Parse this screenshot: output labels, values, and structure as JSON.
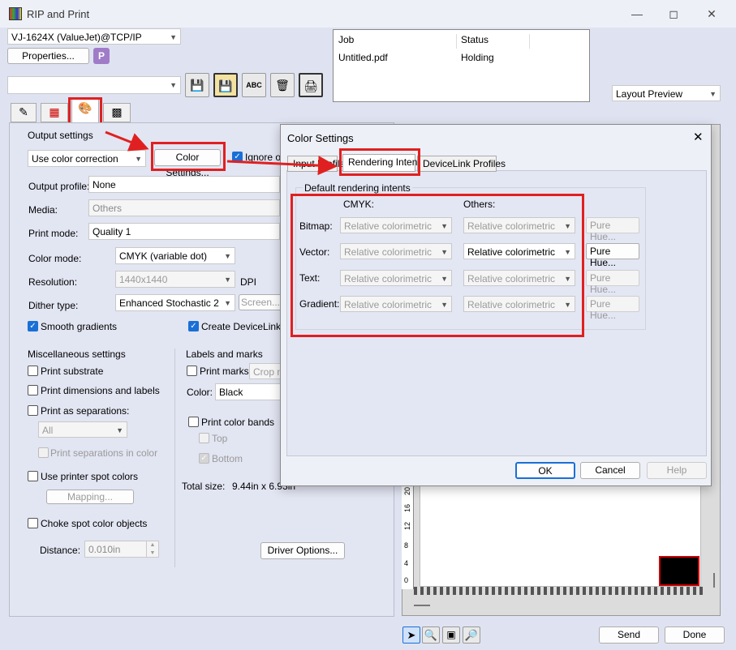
{
  "window": {
    "title": "RIP and Print"
  },
  "printer": {
    "selected": "VJ-1624X (ValueJet)@TCP/IP",
    "properties_label": "Properties..."
  },
  "queue": {
    "columns": [
      "Job",
      "Status"
    ],
    "rows": [
      {
        "job": "Untitled.pdf",
        "status": "Holding"
      }
    ]
  },
  "preview": {
    "mode": "Layout Preview"
  },
  "output_settings": {
    "group_label": "Output settings",
    "color_correction": "Use color correction",
    "color_settings_label": "Color Settings...",
    "ignore_label": "Ignore ov",
    "output_profile_label": "Output profile:",
    "output_profile_value": "None",
    "media_label": "Media:",
    "media_value": "Others",
    "print_mode_label": "Print mode:",
    "print_mode_value": "Quality 1",
    "color_mode_label": "Color mode:",
    "color_mode_value": "CMYK (variable dot)",
    "resolution_label": "Resolution:",
    "resolution_value": "1440x1440",
    "dpi_label": "DPI",
    "dither_label": "Dither type:",
    "dither_value": "Enhanced Stochastic 2",
    "screen_label": "Screen...",
    "smooth_label": "Smooth gradients",
    "devicelinks_label": "Create DeviceLinks o"
  },
  "misc": {
    "group_label": "Miscellaneous settings",
    "print_substrate": "Print substrate",
    "print_dims": "Print dimensions and labels",
    "print_separations": "Print as separations:",
    "separations_value": "All",
    "print_sep_color": "Print separations in color",
    "use_spot": "Use printer spot colors",
    "mapping": "Mapping...",
    "choke": "Choke spot color objects",
    "distance_label": "Distance:",
    "distance_value": "0.010in"
  },
  "labels_marks": {
    "group_label": "Labels and marks",
    "print_marks": "Print marks:",
    "marks_value": "Crop m",
    "color_label": "Color:",
    "color_value": "Black",
    "color_bands": "Print color bands",
    "top": "Top",
    "bottom": "Bottom",
    "total_size_label": "Total size:",
    "total_size_value": "9.44in x  6.93in",
    "driver_options": "Driver Options..."
  },
  "ruler": {
    "ticks": [
      "20",
      "16",
      "12",
      "8",
      "4",
      "0"
    ]
  },
  "footer": {
    "send": "Send",
    "done": "Done"
  },
  "dialog": {
    "title": "Color Settings",
    "tabs": [
      "Input Profile",
      "Rendering Intent",
      "DeviceLink Profiles"
    ],
    "group_label": "Default rendering intents",
    "col_cmyk": "CMYK:",
    "col_others": "Others:",
    "rows": [
      {
        "label": "Bitmap:",
        "cmyk": "Relative colorimetric",
        "others": "Relative colorimetric",
        "pure": "Pure Hue..."
      },
      {
        "label": "Vector:",
        "cmyk": "Relative colorimetric",
        "others": "Relative colorimetric",
        "pure": "Pure Hue..."
      },
      {
        "label": "Text:",
        "cmyk": "Relative colorimetric",
        "others": "Relative colorimetric",
        "pure": "Pure Hue..."
      },
      {
        "label": "Gradient:",
        "cmyk": "Relative colorimetric",
        "others": "Relative colorimetric",
        "pure": "Pure Hue..."
      }
    ],
    "ok": "OK",
    "cancel": "Cancel",
    "help": "Help"
  },
  "colors": {
    "annotation_red": "#e02020",
    "accent_blue": "#1a6fd6",
    "swatch_red": "#cc0000"
  }
}
